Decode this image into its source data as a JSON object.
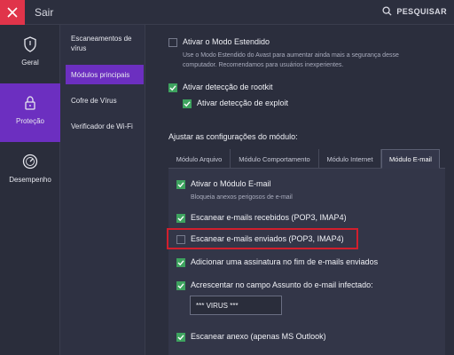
{
  "topbar": {
    "exit_label": "Sair",
    "search_label": "PESQUISAR"
  },
  "rail": {
    "items": [
      {
        "label": "Geral",
        "icon": "shield-icon"
      },
      {
        "label": "Proteção",
        "icon": "lock-icon",
        "active": true
      },
      {
        "label": "Desempenho",
        "icon": "speedometer-icon"
      }
    ]
  },
  "submenu": {
    "items": [
      {
        "label": "Escaneamentos de vírus"
      },
      {
        "label": "Módulos principais",
        "active": true
      },
      {
        "label": "Cofre de Vírus"
      },
      {
        "label": "Verificador de Wi-Fi"
      }
    ]
  },
  "main": {
    "extended_mode": {
      "label": "Ativar o Modo Estendido",
      "checked": false,
      "description_line1": "Use o Modo Estendido do Avast para aumentar ainda mais a segurança desse",
      "description_line2": "computador. Recomendamos para usuários inexperientes."
    },
    "rootkit": {
      "label": "Ativar detecção de rootkit",
      "checked": true
    },
    "exploit": {
      "label": "Ativar detecção de exploit",
      "checked": true
    },
    "module_settings_label": "Ajustar as configurações do módulo:",
    "tabs": [
      {
        "label": "Módulo Arquivo"
      },
      {
        "label": "Módulo Comportamento"
      },
      {
        "label": "Módulo Internet"
      },
      {
        "label": "Módulo E-mail",
        "active": true
      }
    ],
    "email": {
      "enable": {
        "label": "Ativar o Módulo E-mail",
        "checked": true,
        "description": "Bloqueia anexos perigosos de e-mail"
      },
      "scan_received": {
        "label": "Escanear e-mails recebidos (POP3, IMAP4)",
        "checked": true
      },
      "scan_sent": {
        "label": "Escanear e-mails enviados (POP3, IMAP4)",
        "checked": false
      },
      "add_signature": {
        "label": "Adicionar uma assinatura no fim de e-mails enviados",
        "checked": true
      },
      "subject_tag": {
        "label": "Acrescentar no campo Assunto do e-mail infectado:",
        "checked": true,
        "value": "*** VIRUS ***"
      },
      "scan_attachment": {
        "label": "Escanear anexo (apenas MS Outlook)",
        "checked": true
      }
    }
  },
  "colors": {
    "accent": "#6c2fc0",
    "check": "#3ea35f",
    "close": "#e0344a",
    "highlight": "#d21f2d"
  }
}
